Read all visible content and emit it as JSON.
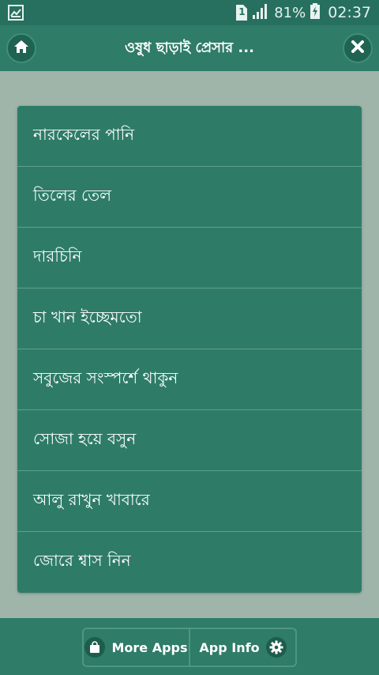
{
  "status_bar": {
    "battery_percent": "81%",
    "time": "02:37",
    "sim_slot": "1",
    "icons": [
      "gallery-notification-icon",
      "sim-icon",
      "signal-icon",
      "battery-charging-icon"
    ]
  },
  "header": {
    "title": "ওষুধ ছাড়াই প্রেসার ...",
    "home_icon": "home-icon",
    "close_icon": "close-icon"
  },
  "list": {
    "items": [
      {
        "label": "নারকেলের পানি"
      },
      {
        "label": "তিলের তেল"
      },
      {
        "label": "দারচিনি"
      },
      {
        "label": "চা খান ইচ্ছেমতো"
      },
      {
        "label": "সবুজের সংস্পর্শে থাকুন"
      },
      {
        "label": "সোজা হয়ে বসুন"
      },
      {
        "label": "আলু রাখুন খাবারে"
      },
      {
        "label": "জোরে শ্বাস নিন"
      }
    ]
  },
  "footer": {
    "more_apps_label": "More Apps",
    "app_info_label": "App Info",
    "more_apps_icon": "shopping-bag-icon",
    "app_info_icon": "gear-icon"
  },
  "colors": {
    "primary": "#2f7c68",
    "status_bar": "#27705f",
    "background": "#9fb5a9",
    "divider": "#5e9f8d"
  }
}
